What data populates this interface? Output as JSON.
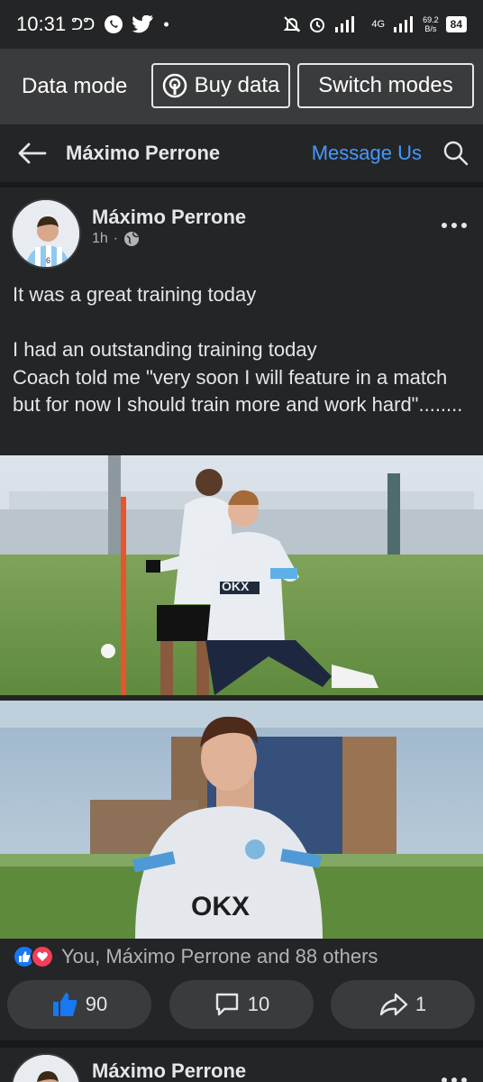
{
  "status": {
    "time": "10:31",
    "carrier_glyph": "ᕤᕤ",
    "network": "4G",
    "speed_value": "69.2",
    "speed_unit": "B/s",
    "battery": "84"
  },
  "data_bar": {
    "label": "Data mode",
    "buy_label": "Buy data",
    "switch_label": "Switch modes"
  },
  "header": {
    "title": "Máximo Perrone",
    "message_label": "Message Us"
  },
  "post": {
    "author": "Máximo Perrone",
    "time": "1h",
    "text": "It was a great training today\n\nI had an outstanding training today\nCoach told me \"very soon I will feature in a match but for now I should train more and work hard\"........",
    "reactions_text": "You, Máximo Perrone and 88 others",
    "likes": "90",
    "comments": "10",
    "shares": "1",
    "player_number": "6",
    "shirt_sponsor": "OKX"
  },
  "post2": {
    "author": "Máximo Perrone"
  },
  "colors": {
    "background": "#242526",
    "accent": "#4599ff",
    "like_blue": "#1877f2",
    "love_red": "#f33e58"
  }
}
